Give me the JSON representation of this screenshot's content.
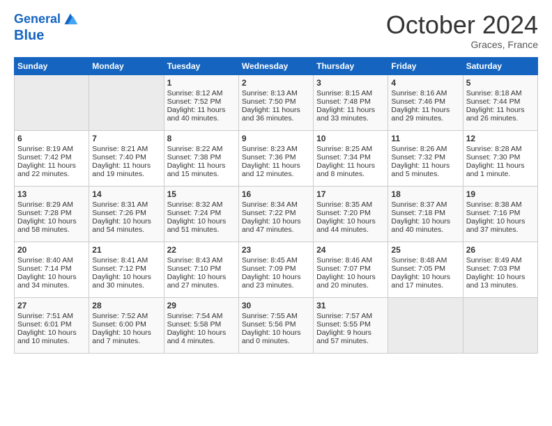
{
  "header": {
    "logo_line1": "General",
    "logo_line2": "Blue",
    "month_title": "October 2024",
    "location": "Graces, France"
  },
  "weekdays": [
    "Sunday",
    "Monday",
    "Tuesday",
    "Wednesday",
    "Thursday",
    "Friday",
    "Saturday"
  ],
  "weeks": [
    [
      {
        "day": "",
        "sunrise": "",
        "sunset": "",
        "daylight": "",
        "empty": true
      },
      {
        "day": "",
        "sunrise": "",
        "sunset": "",
        "daylight": "",
        "empty": true
      },
      {
        "day": "1",
        "sunrise": "Sunrise: 8:12 AM",
        "sunset": "Sunset: 7:52 PM",
        "daylight": "Daylight: 11 hours and 40 minutes."
      },
      {
        "day": "2",
        "sunrise": "Sunrise: 8:13 AM",
        "sunset": "Sunset: 7:50 PM",
        "daylight": "Daylight: 11 hours and 36 minutes."
      },
      {
        "day": "3",
        "sunrise": "Sunrise: 8:15 AM",
        "sunset": "Sunset: 7:48 PM",
        "daylight": "Daylight: 11 hours and 33 minutes."
      },
      {
        "day": "4",
        "sunrise": "Sunrise: 8:16 AM",
        "sunset": "Sunset: 7:46 PM",
        "daylight": "Daylight: 11 hours and 29 minutes."
      },
      {
        "day": "5",
        "sunrise": "Sunrise: 8:18 AM",
        "sunset": "Sunset: 7:44 PM",
        "daylight": "Daylight: 11 hours and 26 minutes."
      }
    ],
    [
      {
        "day": "6",
        "sunrise": "Sunrise: 8:19 AM",
        "sunset": "Sunset: 7:42 PM",
        "daylight": "Daylight: 11 hours and 22 minutes."
      },
      {
        "day": "7",
        "sunrise": "Sunrise: 8:21 AM",
        "sunset": "Sunset: 7:40 PM",
        "daylight": "Daylight: 11 hours and 19 minutes."
      },
      {
        "day": "8",
        "sunrise": "Sunrise: 8:22 AM",
        "sunset": "Sunset: 7:38 PM",
        "daylight": "Daylight: 11 hours and 15 minutes."
      },
      {
        "day": "9",
        "sunrise": "Sunrise: 8:23 AM",
        "sunset": "Sunset: 7:36 PM",
        "daylight": "Daylight: 11 hours and 12 minutes."
      },
      {
        "day": "10",
        "sunrise": "Sunrise: 8:25 AM",
        "sunset": "Sunset: 7:34 PM",
        "daylight": "Daylight: 11 hours and 8 minutes."
      },
      {
        "day": "11",
        "sunrise": "Sunrise: 8:26 AM",
        "sunset": "Sunset: 7:32 PM",
        "daylight": "Daylight: 11 hours and 5 minutes."
      },
      {
        "day": "12",
        "sunrise": "Sunrise: 8:28 AM",
        "sunset": "Sunset: 7:30 PM",
        "daylight": "Daylight: 11 hours and 1 minute."
      }
    ],
    [
      {
        "day": "13",
        "sunrise": "Sunrise: 8:29 AM",
        "sunset": "Sunset: 7:28 PM",
        "daylight": "Daylight: 10 hours and 58 minutes."
      },
      {
        "day": "14",
        "sunrise": "Sunrise: 8:31 AM",
        "sunset": "Sunset: 7:26 PM",
        "daylight": "Daylight: 10 hours and 54 minutes."
      },
      {
        "day": "15",
        "sunrise": "Sunrise: 8:32 AM",
        "sunset": "Sunset: 7:24 PM",
        "daylight": "Daylight: 10 hours and 51 minutes."
      },
      {
        "day": "16",
        "sunrise": "Sunrise: 8:34 AM",
        "sunset": "Sunset: 7:22 PM",
        "daylight": "Daylight: 10 hours and 47 minutes."
      },
      {
        "day": "17",
        "sunrise": "Sunrise: 8:35 AM",
        "sunset": "Sunset: 7:20 PM",
        "daylight": "Daylight: 10 hours and 44 minutes."
      },
      {
        "day": "18",
        "sunrise": "Sunrise: 8:37 AM",
        "sunset": "Sunset: 7:18 PM",
        "daylight": "Daylight: 10 hours and 40 minutes."
      },
      {
        "day": "19",
        "sunrise": "Sunrise: 8:38 AM",
        "sunset": "Sunset: 7:16 PM",
        "daylight": "Daylight: 10 hours and 37 minutes."
      }
    ],
    [
      {
        "day": "20",
        "sunrise": "Sunrise: 8:40 AM",
        "sunset": "Sunset: 7:14 PM",
        "daylight": "Daylight: 10 hours and 34 minutes."
      },
      {
        "day": "21",
        "sunrise": "Sunrise: 8:41 AM",
        "sunset": "Sunset: 7:12 PM",
        "daylight": "Daylight: 10 hours and 30 minutes."
      },
      {
        "day": "22",
        "sunrise": "Sunrise: 8:43 AM",
        "sunset": "Sunset: 7:10 PM",
        "daylight": "Daylight: 10 hours and 27 minutes."
      },
      {
        "day": "23",
        "sunrise": "Sunrise: 8:45 AM",
        "sunset": "Sunset: 7:09 PM",
        "daylight": "Daylight: 10 hours and 23 minutes."
      },
      {
        "day": "24",
        "sunrise": "Sunrise: 8:46 AM",
        "sunset": "Sunset: 7:07 PM",
        "daylight": "Daylight: 10 hours and 20 minutes."
      },
      {
        "day": "25",
        "sunrise": "Sunrise: 8:48 AM",
        "sunset": "Sunset: 7:05 PM",
        "daylight": "Daylight: 10 hours and 17 minutes."
      },
      {
        "day": "26",
        "sunrise": "Sunrise: 8:49 AM",
        "sunset": "Sunset: 7:03 PM",
        "daylight": "Daylight: 10 hours and 13 minutes."
      }
    ],
    [
      {
        "day": "27",
        "sunrise": "Sunrise: 7:51 AM",
        "sunset": "Sunset: 6:01 PM",
        "daylight": "Daylight: 10 hours and 10 minutes."
      },
      {
        "day": "28",
        "sunrise": "Sunrise: 7:52 AM",
        "sunset": "Sunset: 6:00 PM",
        "daylight": "Daylight: 10 hours and 7 minutes."
      },
      {
        "day": "29",
        "sunrise": "Sunrise: 7:54 AM",
        "sunset": "Sunset: 5:58 PM",
        "daylight": "Daylight: 10 hours and 4 minutes."
      },
      {
        "day": "30",
        "sunrise": "Sunrise: 7:55 AM",
        "sunset": "Sunset: 5:56 PM",
        "daylight": "Daylight: 10 hours and 0 minutes."
      },
      {
        "day": "31",
        "sunrise": "Sunrise: 7:57 AM",
        "sunset": "Sunset: 5:55 PM",
        "daylight": "Daylight: 9 hours and 57 minutes."
      },
      {
        "day": "",
        "sunrise": "",
        "sunset": "",
        "daylight": "",
        "empty": true
      },
      {
        "day": "",
        "sunrise": "",
        "sunset": "",
        "daylight": "",
        "empty": true
      }
    ]
  ]
}
